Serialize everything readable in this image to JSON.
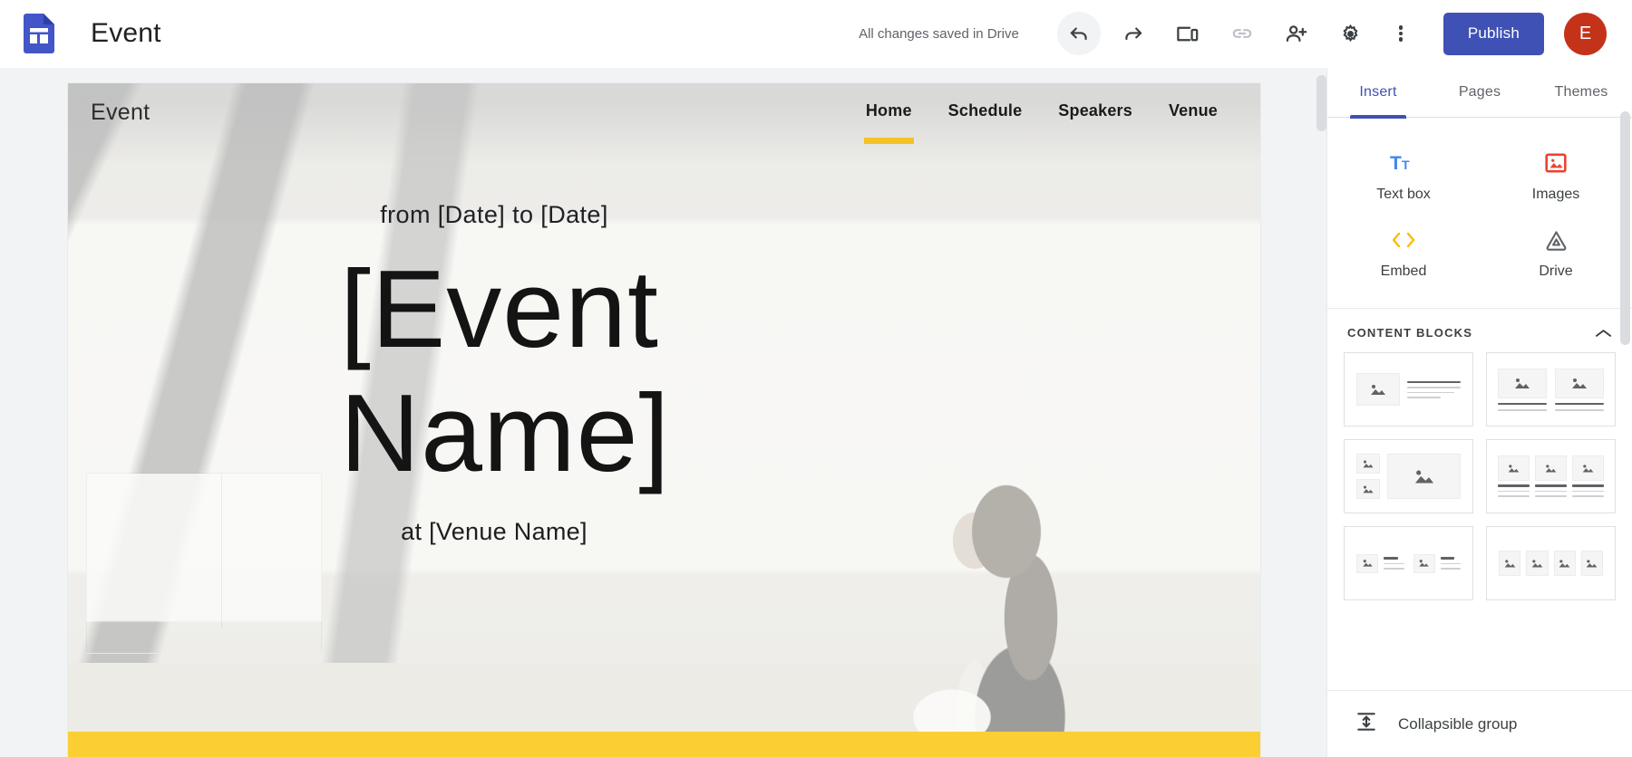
{
  "topbar": {
    "logo_icon": "google-sites-icon",
    "doc_title": "Event",
    "save_status": "All changes saved in Drive",
    "icons": [
      {
        "name": "undo-icon",
        "label": "Undo"
      },
      {
        "name": "redo-icon",
        "label": "Redo"
      },
      {
        "name": "preview-icon",
        "label": "Preview"
      },
      {
        "name": "copy-link-icon",
        "label": "Copy published site link"
      },
      {
        "name": "share-icon",
        "label": "Share with others"
      },
      {
        "name": "settings-gear-icon",
        "label": "Settings"
      },
      {
        "name": "more-options-icon",
        "label": "More"
      }
    ],
    "publish_label": "Publish",
    "avatar_initial": "E",
    "accent_blue": "#3f51b5",
    "avatar_color": "#c5321a"
  },
  "site": {
    "logo_text": "Event",
    "nav": [
      {
        "label": "Home",
        "active": true
      },
      {
        "label": "Schedule",
        "active": false
      },
      {
        "label": "Speakers",
        "active": false
      },
      {
        "label": "Venue",
        "active": false
      }
    ],
    "hero": {
      "dates": "from [Date] to [Date]",
      "title": "[Event Name]",
      "venue": "at [Venue Name]",
      "accent_band_color": "#fbcf33"
    }
  },
  "panel": {
    "tabs": [
      {
        "label": "Insert",
        "active": true
      },
      {
        "label": "Pages",
        "active": false
      },
      {
        "label": "Themes",
        "active": false
      }
    ],
    "insert_items": [
      {
        "label": "Text box",
        "icon": "text-box-icon",
        "color": "#4285f4"
      },
      {
        "label": "Images",
        "icon": "images-icon",
        "color": "#ea4335"
      },
      {
        "label": "Embed",
        "icon": "embed-code-icon",
        "color": "#fbbc04"
      },
      {
        "label": "Drive",
        "icon": "google-drive-icon",
        "color": "#5f6368"
      }
    ],
    "content_blocks": {
      "title": "CONTENT BLOCKS",
      "collapse_icon": "chevron-up-icon",
      "layouts": [
        {
          "name": "image-left-text-right"
        },
        {
          "name": "two-images-with-captions"
        },
        {
          "name": "two-small-images-one-large"
        },
        {
          "name": "three-images-with-captions"
        },
        {
          "name": "two-image-text-pairs"
        },
        {
          "name": "four-image-row"
        }
      ]
    },
    "collapsible_group": {
      "label": "Collapsible group",
      "icon": "collapsible-group-icon"
    }
  }
}
